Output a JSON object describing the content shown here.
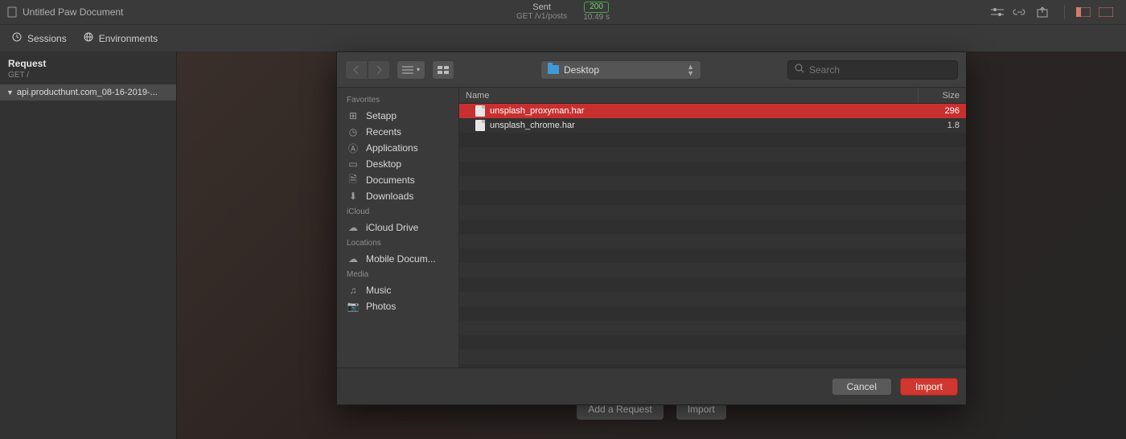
{
  "titlebar": {
    "title": "Untitled Paw Document"
  },
  "status": {
    "state": "Sent",
    "path": "GET /v1/posts",
    "code": "200",
    "timing": "10.49 s"
  },
  "subtabs": {
    "sessions": "Sessions",
    "environments": "Environments"
  },
  "request_panel": {
    "title": "Request",
    "method_path": "GET /",
    "tree_item": "api.producthunt.com_08-16-2019-..."
  },
  "footer_buttons": {
    "add": "Add a Request",
    "import": "Import"
  },
  "dialog": {
    "path_label": "Desktop",
    "search_placeholder": "Search",
    "sidebar": {
      "sections": {
        "favorites": {
          "label": "Favorites",
          "items": [
            "Setapp",
            "Recents",
            "Applications",
            "Desktop",
            "Documents",
            "Downloads"
          ]
        },
        "icloud": {
          "label": "iCloud",
          "items": [
            "iCloud Drive"
          ]
        },
        "locations": {
          "label": "Locations",
          "items": [
            "Mobile Docum..."
          ]
        },
        "media": {
          "label": "Media",
          "items": [
            "Music",
            "Photos"
          ]
        }
      }
    },
    "columns": {
      "name": "Name",
      "size": "Size"
    },
    "files": [
      {
        "name": "unsplash_proxyman.har",
        "size": "296",
        "selected": true
      },
      {
        "name": "unsplash_chrome.har",
        "size": "1.8",
        "selected": false
      }
    ],
    "buttons": {
      "cancel": "Cancel",
      "import": "Import"
    }
  }
}
